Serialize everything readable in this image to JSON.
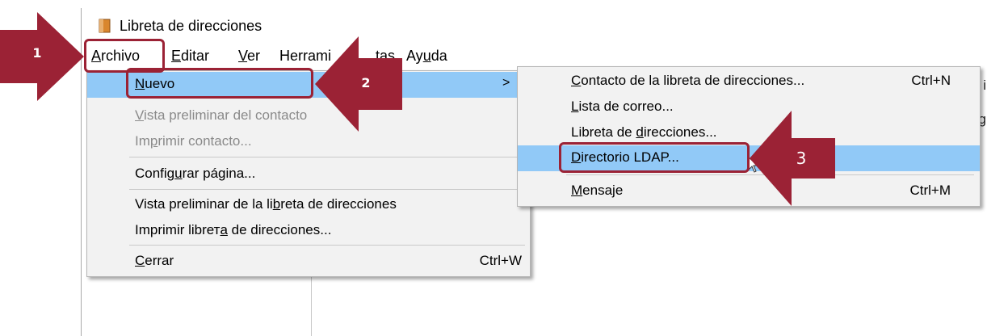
{
  "window": {
    "title": "Libreta de direcciones"
  },
  "menubar": {
    "archivo": {
      "underlined": "A",
      "rest": "rchivo"
    },
    "editar": {
      "underlined": "E",
      "rest": "ditar"
    },
    "ver": {
      "underlined": "V",
      "rest": "er"
    },
    "herramientas_visible": "Herrami",
    "herramientas_tail": "tas",
    "ayuda": {
      "before": "Ay",
      "underlined": "u",
      "after": "da"
    }
  },
  "archivo_menu": {
    "nuevo": {
      "underlined": "N",
      "rest": "uevo",
      "arrow": ">"
    },
    "vista_contacto": {
      "underlined": "V",
      "rest": "ista preliminar del contacto"
    },
    "imprimir_contacto": {
      "before": "Im",
      "underlined": "p",
      "after": "rimir contacto..."
    },
    "configurar": {
      "before": "Config",
      "underlined": "u",
      "after": "rar página..."
    },
    "vista_libreta": {
      "before": "Vista preliminar de la li",
      "underlined": "b",
      "after": "reta de direcciones"
    },
    "imprimir_libreta": {
      "before": "Imprimir librет",
      "underlined": "a",
      "after": " de direcciones..."
    },
    "cerrar": {
      "underlined": "C",
      "rest": "errar",
      "shortcut": "Ctrl+W"
    }
  },
  "nuevo_submenu": {
    "contacto": {
      "underlined": "C",
      "rest": "ontacto de la libreta de direcciones...",
      "shortcut": "Ctrl+N"
    },
    "lista": {
      "underlined": "L",
      "rest": "ista de correo..."
    },
    "libreta": {
      "before": "Libreta de ",
      "underlined": "d",
      "after": "irecciones..."
    },
    "ldap": {
      "underlined": "D",
      "rest": "irectorio LDAP..."
    },
    "mensaje": {
      "underlined": "M",
      "rest": "ensaje",
      "shortcut": "Ctrl+M"
    }
  },
  "background_partial": {
    "right_edge_top": "i",
    "right_edge_mid": "g"
  },
  "steps": {
    "one": "1",
    "two": "2",
    "three": "3"
  },
  "colors": {
    "accent_red": "#9b2235",
    "menu_highlight": "#91c9f7",
    "menu_bg": "#f2f2f2",
    "disabled_text": "#8a8a8a"
  },
  "icons": {
    "app": "address-book-icon",
    "submenu_arrow": "chevron-right-icon",
    "cursor": "mouse-pointer-icon"
  }
}
